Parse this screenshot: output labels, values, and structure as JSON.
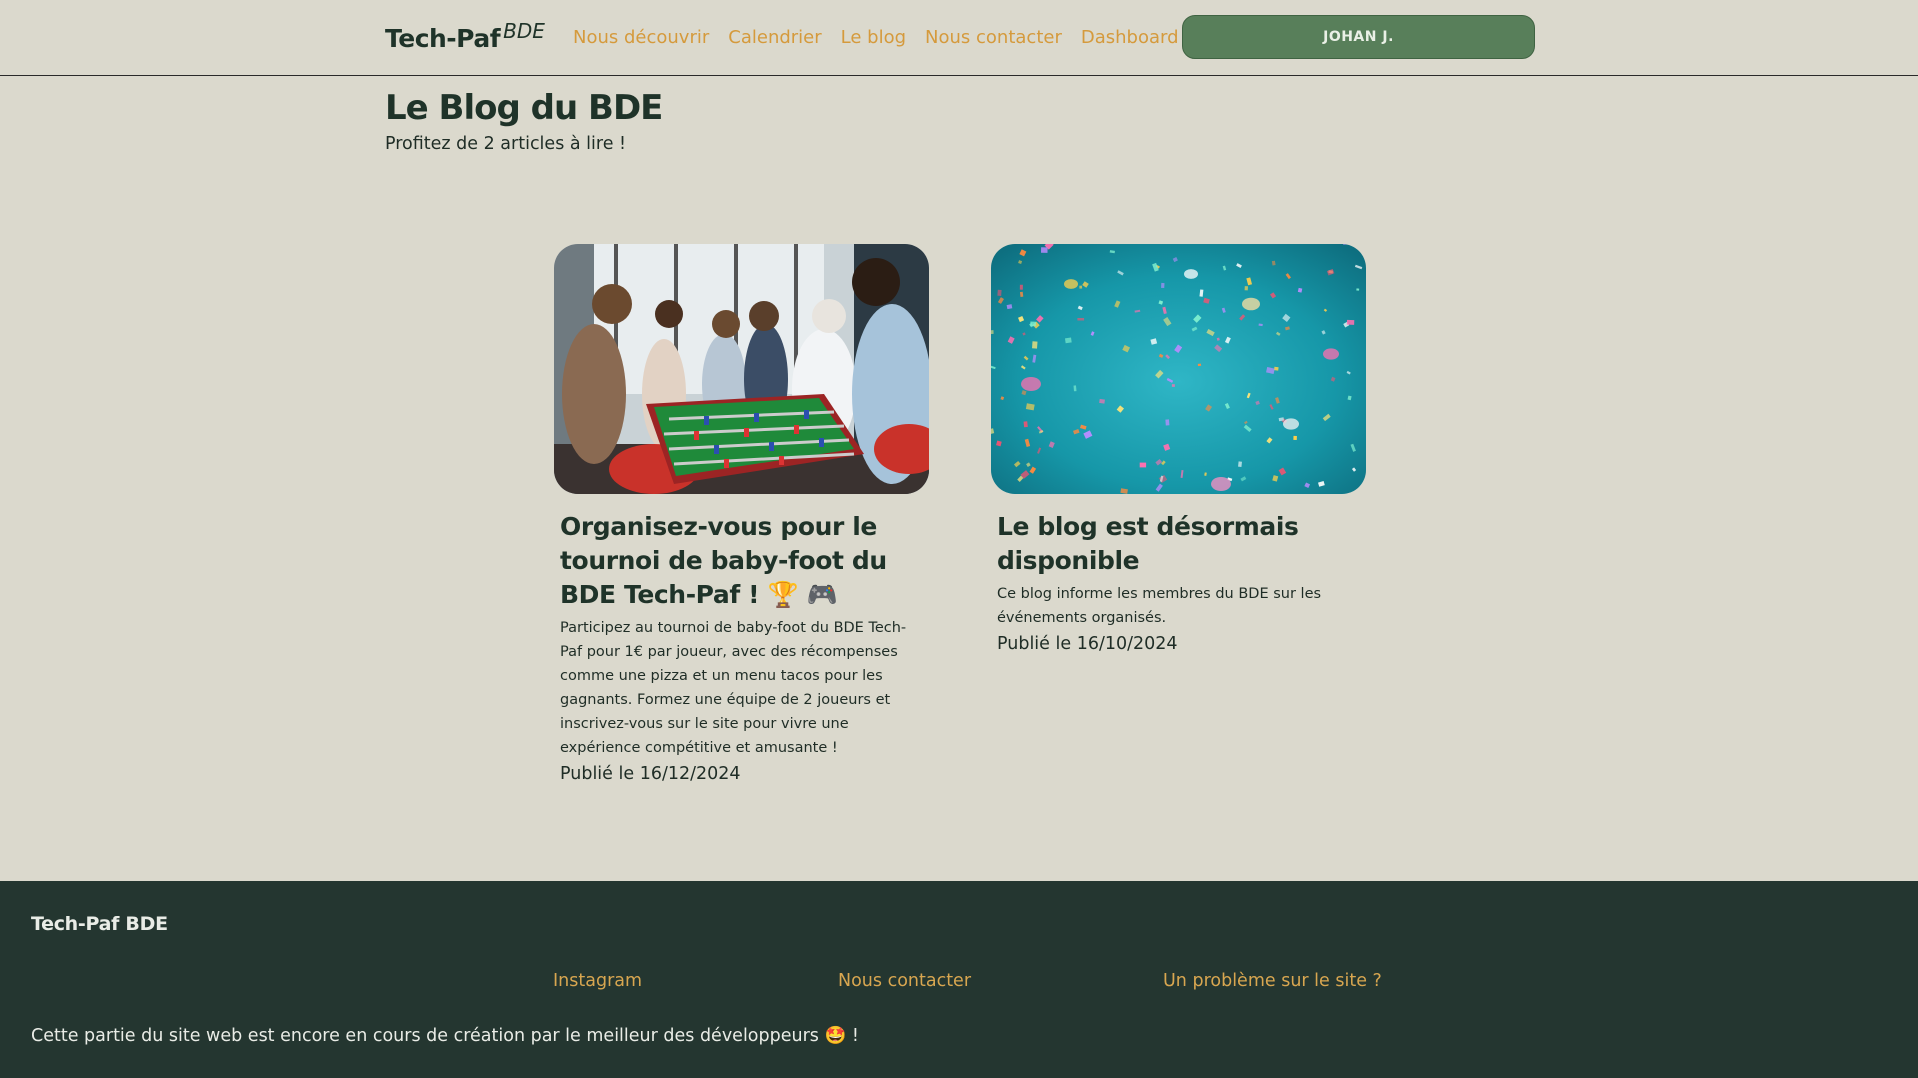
{
  "header": {
    "logo": "Tech-Paf",
    "logo_sup": "BDE",
    "nav": [
      "Nous découvrir",
      "Calendrier",
      "Le blog",
      "Nous contacter",
      "Dashboard"
    ],
    "user_button": "JOHAN J."
  },
  "main": {
    "title": "Le Blog du BDE",
    "subtitle": "Profitez de 2 articles à lire !"
  },
  "articles": [
    {
      "title": "Organisez-vous pour le tournoi de baby-foot du BDE Tech-Paf ! 🏆 🎮",
      "description": "Participez au tournoi de baby-foot du BDE Tech-Paf pour 1€ par joueur, avec des récompenses comme une pizza et un menu tacos pour les gagnants. Formez une équipe de 2 joueurs et inscrivez-vous sur le site pour vivre une expérience compétitive et amusante !",
      "date": "Publié le 16/12/2024"
    },
    {
      "title": "Le blog est désormais disponible",
      "description": "Ce blog informe les membres du BDE sur les événements organisés.",
      "date": "Publié le 16/10/2024"
    }
  ],
  "footer": {
    "brand": "Tech-Paf BDE",
    "links": [
      "Instagram",
      "Nous contacter",
      "Un problème sur le site ?"
    ],
    "note": "Cette partie du site web est encore en cours de création par le meilleur des développeurs 🤩 !"
  },
  "colors": {
    "background": "#dbd9cd",
    "accent": "#d59a3c",
    "button": "#587f5a",
    "footer": "#243630",
    "heading": "#1f3329"
  }
}
